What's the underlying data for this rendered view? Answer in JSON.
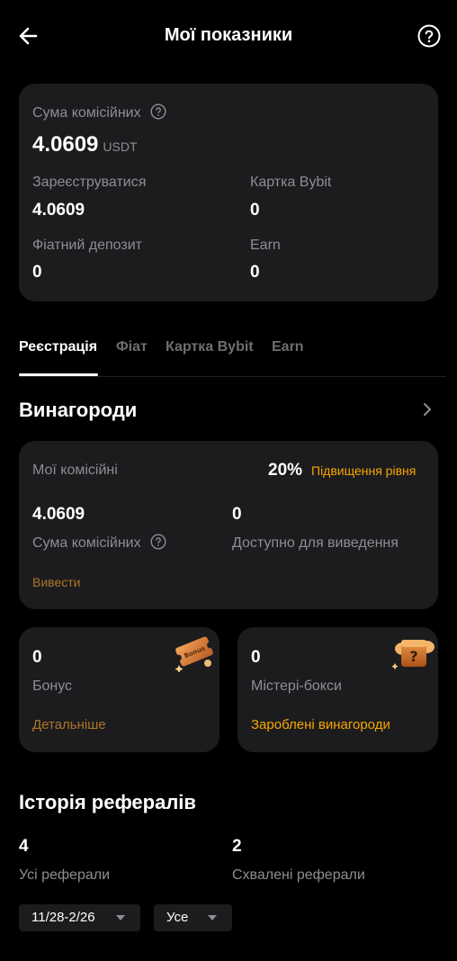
{
  "header": {
    "title": "Мої показники"
  },
  "summary": {
    "total_label": "Сума комісійних",
    "total_value": "4.0609",
    "total_unit": "USDT",
    "items": [
      {
        "label": "Зареєструватися",
        "value": "4.0609"
      },
      {
        "label": "Картка Bybit",
        "value": "0"
      },
      {
        "label": "Фіатний депозит",
        "value": "0"
      },
      {
        "label": "Earn",
        "value": "0"
      }
    ]
  },
  "tabs": [
    "Реєстрація",
    "Фіат",
    "Картка Bybit",
    "Earn"
  ],
  "active_tab": "Реєстрація",
  "rewards": {
    "title": "Винагороди",
    "my_commissions_label": "Мої комісійні",
    "rate": "20%",
    "upgrade_link": "Підвищення рівня",
    "sum_value": "4.0609",
    "sum_label": "Сума комісійних",
    "available_value": "0",
    "available_label": "Доступно для виведення",
    "withdraw_link": "Вивести"
  },
  "bonus": {
    "value": "0",
    "label": "Бонус",
    "link": "Детальніше",
    "badge_text": "Bonus"
  },
  "mystery": {
    "value": "0",
    "label": "Містері-бокси",
    "link": "Зароблені винагороди"
  },
  "referrals": {
    "title": "Історія рефералів",
    "all_value": "4",
    "all_label": "Усі реферали",
    "approved_value": "2",
    "approved_label": "Схвалені реферали"
  },
  "filters": {
    "date_range": "11/28-2/26",
    "status": "Усе"
  },
  "colors": {
    "accent": "#f7a600",
    "muted_link": "#b0742a",
    "card_bg": "#1c1c1e",
    "background": "#000000"
  }
}
